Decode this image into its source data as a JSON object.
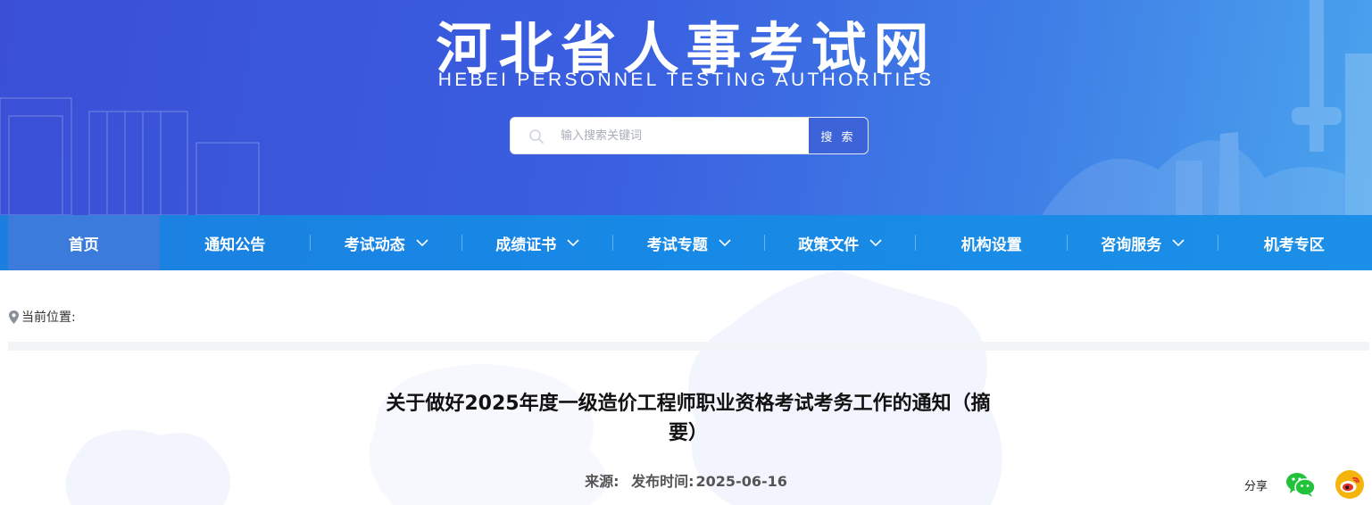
{
  "header": {
    "title": "河北省人事考试网",
    "subtitle": "HEBEI  PERSONNEL  TESTING AUTHORITIES",
    "search": {
      "placeholder": "输入搜索关键词",
      "value": "",
      "button_label": "搜 索",
      "icon": "search-icon"
    }
  },
  "nav": {
    "items": [
      {
        "label": "首页",
        "active": true,
        "dropdown": false
      },
      {
        "label": "通知公告",
        "active": false,
        "dropdown": false
      },
      {
        "label": "考试动态",
        "active": false,
        "dropdown": true
      },
      {
        "label": "成绩证书",
        "active": false,
        "dropdown": true
      },
      {
        "label": "考试专题",
        "active": false,
        "dropdown": true
      },
      {
        "label": "政策文件",
        "active": false,
        "dropdown": true
      },
      {
        "label": "机构设置",
        "active": false,
        "dropdown": false
      },
      {
        "label": "咨询服务",
        "active": false,
        "dropdown": true
      },
      {
        "label": "机考专区",
        "active": false,
        "dropdown": false
      }
    ]
  },
  "breadcrumb": {
    "icon": "location-pin-icon",
    "label": "当前位置:"
  },
  "article": {
    "title_line1": "关于做好2025年度一级造价工程师职业资格考试考务工作的通知（摘",
    "title_line2": "要）",
    "source_label": "来源:",
    "source_value": "",
    "date_label": "发布时间:",
    "date_value": "2025-06-16"
  },
  "share": {
    "label": "分享",
    "wechat_icon": "wechat-icon",
    "weibo_icon": "weibo-icon"
  },
  "colors": {
    "banner_start": "#3a4fd6",
    "banner_end": "#4aa4ee",
    "nav_bg": "#1789e6",
    "nav_active": "#3a7bdc",
    "search_button": "#3d63d8",
    "wechat": "#22c33a",
    "weibo": "#f5b40c"
  }
}
